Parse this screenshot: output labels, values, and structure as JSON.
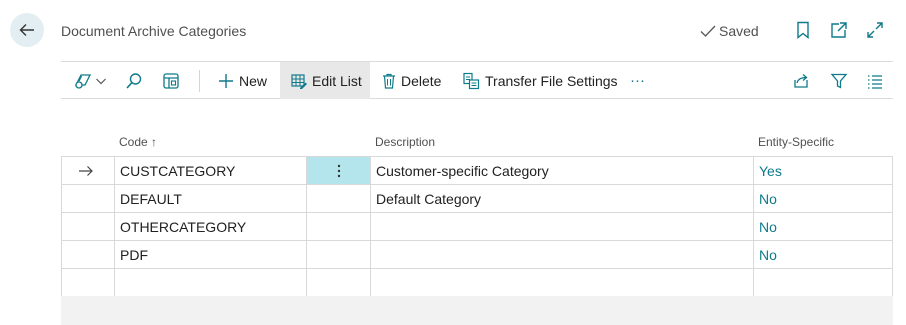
{
  "header": {
    "title": "Document Archive Categories",
    "saved_label": "Saved"
  },
  "toolbar": {
    "new_label": "New",
    "edit_list_label": "Edit List",
    "delete_label": "Delete",
    "transfer_label": "Transfer File Settings",
    "more_label": "···"
  },
  "grid": {
    "columns": {
      "code": "Code",
      "description": "Description",
      "entity_specific": "Entity-Specific"
    },
    "rows": [
      {
        "code": "CUSTCATEGORY",
        "description": "Customer-specific Category",
        "entity_specific": "Yes"
      },
      {
        "code": "DEFAULT",
        "description": "Default Category",
        "entity_specific": "No"
      },
      {
        "code": "OTHERCATEGORY",
        "description": "",
        "entity_specific": "No"
      },
      {
        "code": "PDF",
        "description": "",
        "entity_specific": "No"
      }
    ]
  },
  "colors": {
    "accent": "#0f7a8a",
    "selected_cell": "#b5e5ec"
  }
}
